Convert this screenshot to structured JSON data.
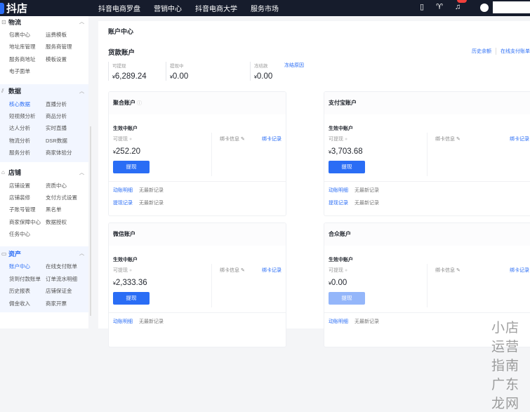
{
  "topbar": {
    "logo": "抖店",
    "nav": [
      "抖音电商罗盘",
      "营销中心",
      "抖音电商大学",
      "服务市场"
    ],
    "icons": [
      "phone-icon",
      "bird-icon",
      "bell-icon",
      "user-avatar-icon"
    ]
  },
  "sidebar": {
    "groups": [
      {
        "title": "物流",
        "icon": "box-icon",
        "items": [
          "包裹中心",
          "运费模板",
          "地址库管理",
          "服务商管理",
          "服务商地址",
          "模板设置",
          "电子面单"
        ]
      },
      {
        "title": "数据",
        "icon": "chart-icon",
        "items": [
          "核心数据",
          "直播分析",
          "短视频分析",
          "商品分析",
          "达人分析",
          "实时直播",
          "物流分析",
          "DSR数据",
          "服务分析",
          "商家体验分"
        ],
        "active": "核心数据"
      },
      {
        "title": "店铺",
        "icon": "store-icon",
        "items": [
          "店铺设置",
          "资质中心",
          "店铺装修",
          "支付方式设置",
          "子账号管理",
          "黑名单",
          "商家保障中心",
          "数据授权",
          "任务中心"
        ]
      },
      {
        "title": "资产",
        "icon": "wallet-icon",
        "items": [
          "账户中心",
          "在线支付账单",
          "货到付款账单",
          "订单流水明细",
          "历史报表",
          "店铺保证金",
          "佣金收入",
          "商家开票"
        ],
        "active": "账户中心"
      }
    ]
  },
  "main": {
    "page_title": "账户中心",
    "section_title": "货款账户",
    "links": [
      "历史余额",
      "在线支付账单"
    ],
    "stats": [
      {
        "label": "可提现",
        "value": "6,289.24"
      },
      {
        "label": "提现中",
        "value": "0.00"
      },
      {
        "label": "冻结款",
        "value": "0.00",
        "link": "冻结原因"
      }
    ],
    "currency": "¥",
    "cards": [
      {
        "title": "聚合账户",
        "status": "生效中账户",
        "avail_label": "可提现",
        "amount": "252.20",
        "button": "提现",
        "bind_info": "绑卡信息",
        "bind_record": "绑卡记录",
        "footer": [
          {
            "link": "动账明细",
            "text": "无最新记录"
          },
          {
            "link": "提现记录",
            "text": "无最新记录"
          }
        ]
      },
      {
        "title": "支付宝账户",
        "status": "生效中账户",
        "avail_label": "可提现",
        "amount": "3,703.68",
        "button": "提现",
        "bind_info": "绑卡信息",
        "bind_record": "绑卡记录",
        "footer": [
          {
            "link": "动账明细",
            "text": "无最新记录"
          },
          {
            "link": "提现记录",
            "text": "无最新记录"
          }
        ]
      },
      {
        "title": "微信账户",
        "status": "生效中账户",
        "avail_label": "可提现",
        "amount": "2,333.36",
        "button": "提现",
        "bind_info": "绑卡信息",
        "bind_record": "绑卡记录",
        "footer": [
          {
            "link": "动账明细",
            "text": "无最新记录"
          }
        ]
      },
      {
        "title": "合众账户",
        "status": "生效中账户",
        "avail_label": "可提现",
        "amount": "0.00",
        "button": "提现",
        "button_disabled": true,
        "bind_info": "绑卡信息",
        "bind_record": "绑卡记录",
        "footer": [
          {
            "link": "动账明细",
            "text": "无最新记录"
          }
        ]
      }
    ]
  },
  "watermark": "小店运营指南 广东龙网",
  "colors": {
    "accent": "#2a6df5",
    "topbar": "#161c2c"
  }
}
